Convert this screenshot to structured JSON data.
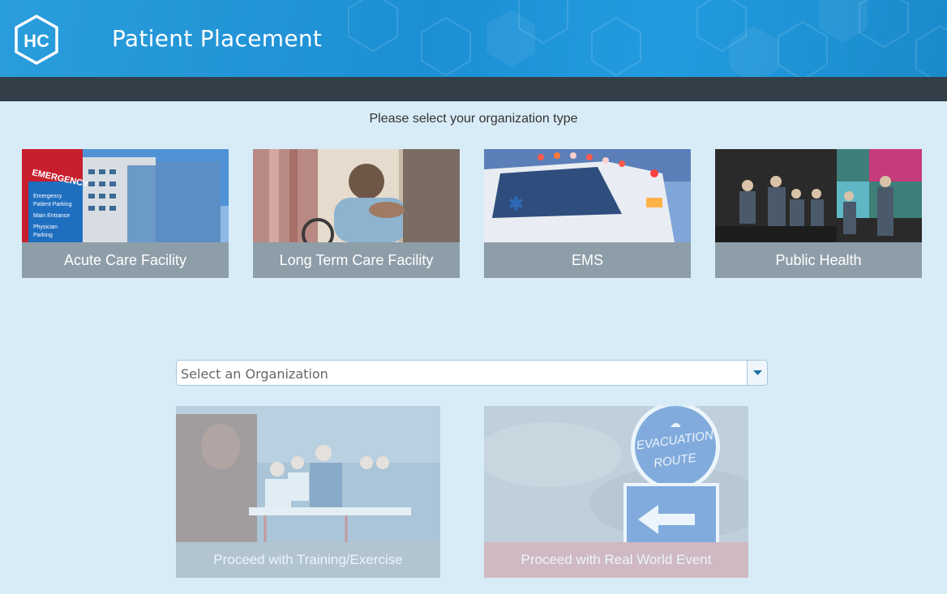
{
  "app": {
    "title": "Patient Placement",
    "logo_text": "HC"
  },
  "prompt": "Please select your organization type",
  "org_types": [
    {
      "label": "Acute Care Facility",
      "image": "hospital-building-emergency-sign"
    },
    {
      "label": "Long Term Care Facility",
      "image": "caregiver-with-patient-wheelchair"
    },
    {
      "label": "EMS",
      "image": "ambulance-lights"
    },
    {
      "label": "Public Health",
      "image": "people-in-command-center"
    }
  ],
  "org_select": {
    "placeholder": "Select an Organization"
  },
  "proceed": {
    "training_label": "Proceed with Training/Exercise",
    "real_world_label": "Proceed with Real World Event",
    "sign_line1": "EVACUATION",
    "sign_line2": "ROUTE"
  },
  "colors": {
    "header_blue": "#2a9ddc",
    "subbar": "#333f48",
    "background": "#d8ecf7",
    "card_label": "#8e9ea9",
    "training_label": "#8e9ea9",
    "real_world_label": "#c9888f"
  }
}
